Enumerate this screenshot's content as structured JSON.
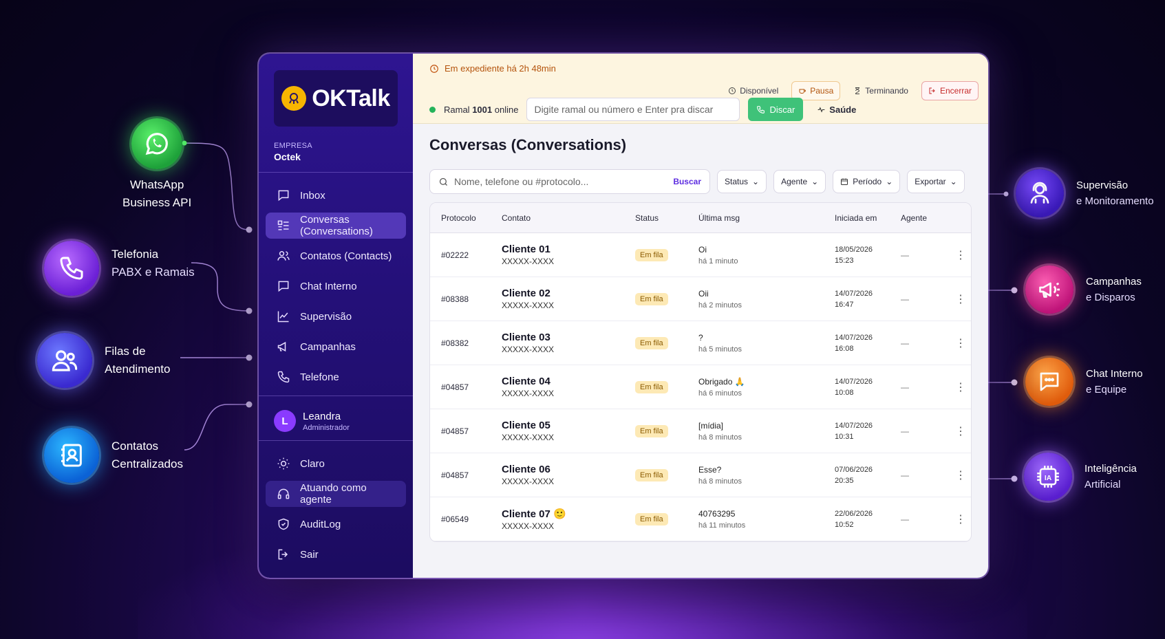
{
  "features_left": [
    {
      "id": "whatsapp",
      "line1": "WhatsApp",
      "line2": "Business API",
      "icon": "whatsapp-icon"
    },
    {
      "id": "telefonia",
      "line1": "Telefonia",
      "line2": "PABX e Ramais",
      "icon": "phone-icon"
    },
    {
      "id": "filas",
      "line1": "Filas de",
      "line2": "Atendimento",
      "icon": "users-icon"
    },
    {
      "id": "contatos",
      "line1": "Contatos",
      "line2": "Centralizados",
      "icon": "contact-card-icon"
    }
  ],
  "features_right": [
    {
      "id": "supervisao",
      "line1": "Supervisão",
      "line2": "e Monitoramento",
      "icon": "headset-person-icon"
    },
    {
      "id": "campanhas",
      "line1": "Campanhas",
      "line2": "e Disparos",
      "icon": "megaphone-icon"
    },
    {
      "id": "chat",
      "line1": "Chat Interno",
      "line2": "e Equipe",
      "icon": "chat-bubble-icon"
    },
    {
      "id": "ia",
      "line1": "Inteligência",
      "line2": "Artificial",
      "icon": "ai-chip-icon"
    }
  ],
  "sidebar": {
    "logo_text": "OKTalk",
    "company_label": "EMPRESA",
    "company_name": "Octek",
    "nav": [
      {
        "label": "Inbox",
        "icon": "inbox-icon"
      },
      {
        "label": "Conversas (Conversations)",
        "icon": "list-icon",
        "active": true
      },
      {
        "label": "Contatos (Contacts)",
        "icon": "users-icon"
      },
      {
        "label": "Chat Interno",
        "icon": "message-square-icon"
      },
      {
        "label": "Supervisão",
        "icon": "chart-line-icon"
      },
      {
        "label": "Campanhas",
        "icon": "megaphone-icon"
      },
      {
        "label": "Telefone",
        "icon": "phone-icon"
      }
    ],
    "user": {
      "initial": "L",
      "name": "Leandra",
      "role": "Administrador"
    },
    "bottom": [
      {
        "label": "Claro",
        "icon": "sun-icon"
      },
      {
        "label": "Atuando como agente",
        "icon": "headphones-icon"
      },
      {
        "label": "AuditLog",
        "icon": "shield-icon"
      },
      {
        "label": "Sair",
        "icon": "logout-icon"
      }
    ]
  },
  "topbar": {
    "shift_text": "Em expediente há 2h 48min",
    "status": {
      "disponivel": "Disponível",
      "pausa": "Pausa",
      "terminando": "Terminando",
      "encerrar": "Encerrar"
    },
    "ramal_prefix": "Ramal",
    "ramal_number": "1001",
    "ramal_suffix": "online",
    "dial_placeholder": "Digite ramal ou número e Enter pra discar",
    "discar": "Discar",
    "saude": "Saúde"
  },
  "page": {
    "title": "Conversas (Conversations)",
    "search_placeholder": "Nome, telefone ou #protocolo...",
    "buscar": "Buscar",
    "filters": {
      "status": "Status",
      "agente": "Agente",
      "periodo": "Período",
      "exportar": "Exportar"
    }
  },
  "table": {
    "headers": [
      "Protocolo",
      "Contato",
      "Status",
      "Última msg",
      "Iniciada em",
      "Agente"
    ],
    "rows": [
      {
        "protocolo": "#02222",
        "nome": "Cliente 01",
        "telefone": "XXXXX-XXXX",
        "status": "Em fila",
        "msg": "Oi",
        "ago": "há 1 minuto",
        "data": "18/05/2026",
        "hora": "15:23",
        "agente": "—"
      },
      {
        "protocolo": "#08388",
        "nome": "Cliente 02",
        "telefone": "XXXXX-XXXX",
        "status": "Em fila",
        "msg": "Oii",
        "ago": "há 2 minutos",
        "data": "14/07/2026",
        "hora": "16:47",
        "agente": "—"
      },
      {
        "protocolo": "#08382",
        "nome": "Cliente 03",
        "telefone": "XXXXX-XXXX",
        "status": "Em fila",
        "msg": "?",
        "ago": "há 5 minutos",
        "data": "14/07/2026",
        "hora": "16:08",
        "agente": "—"
      },
      {
        "protocolo": "#04857",
        "nome": "Cliente 04",
        "telefone": "XXXXX-XXXX",
        "status": "Em fila",
        "msg": "Obrigado 🙏",
        "ago": "há 6 minutos",
        "data": "14/07/2026",
        "hora": "10:08",
        "agente": "—"
      },
      {
        "protocolo": "#04857",
        "nome": "Cliente 05",
        "telefone": "XXXXX-XXXX",
        "status": "Em fila",
        "msg": "[mídia]",
        "ago": "há 8 minutos",
        "data": "14/07/2026",
        "hora": "10:31",
        "agente": "—"
      },
      {
        "protocolo": "#04857",
        "nome": "Cliente 06",
        "telefone": "XXXXX-XXXX",
        "status": "Em fila",
        "msg": "Esse?",
        "ago": "há 8 minutos",
        "data": "07/06/2026",
        "hora": "20:35",
        "agente": "—"
      },
      {
        "protocolo": "#06549",
        "nome": "Cliente 07 🙂",
        "telefone": "XXXXX-XXXX",
        "status": "Em fila",
        "msg": "40763295",
        "ago": "há 11 minutos",
        "data": "22/06/2026",
        "hora": "10:52",
        "agente": "—"
      }
    ]
  },
  "colors": {
    "accent": "#5d2de0",
    "sidebar": "#241079",
    "online": "#24b35a",
    "discar": "#3fc279",
    "badge": "#fde9b5"
  }
}
